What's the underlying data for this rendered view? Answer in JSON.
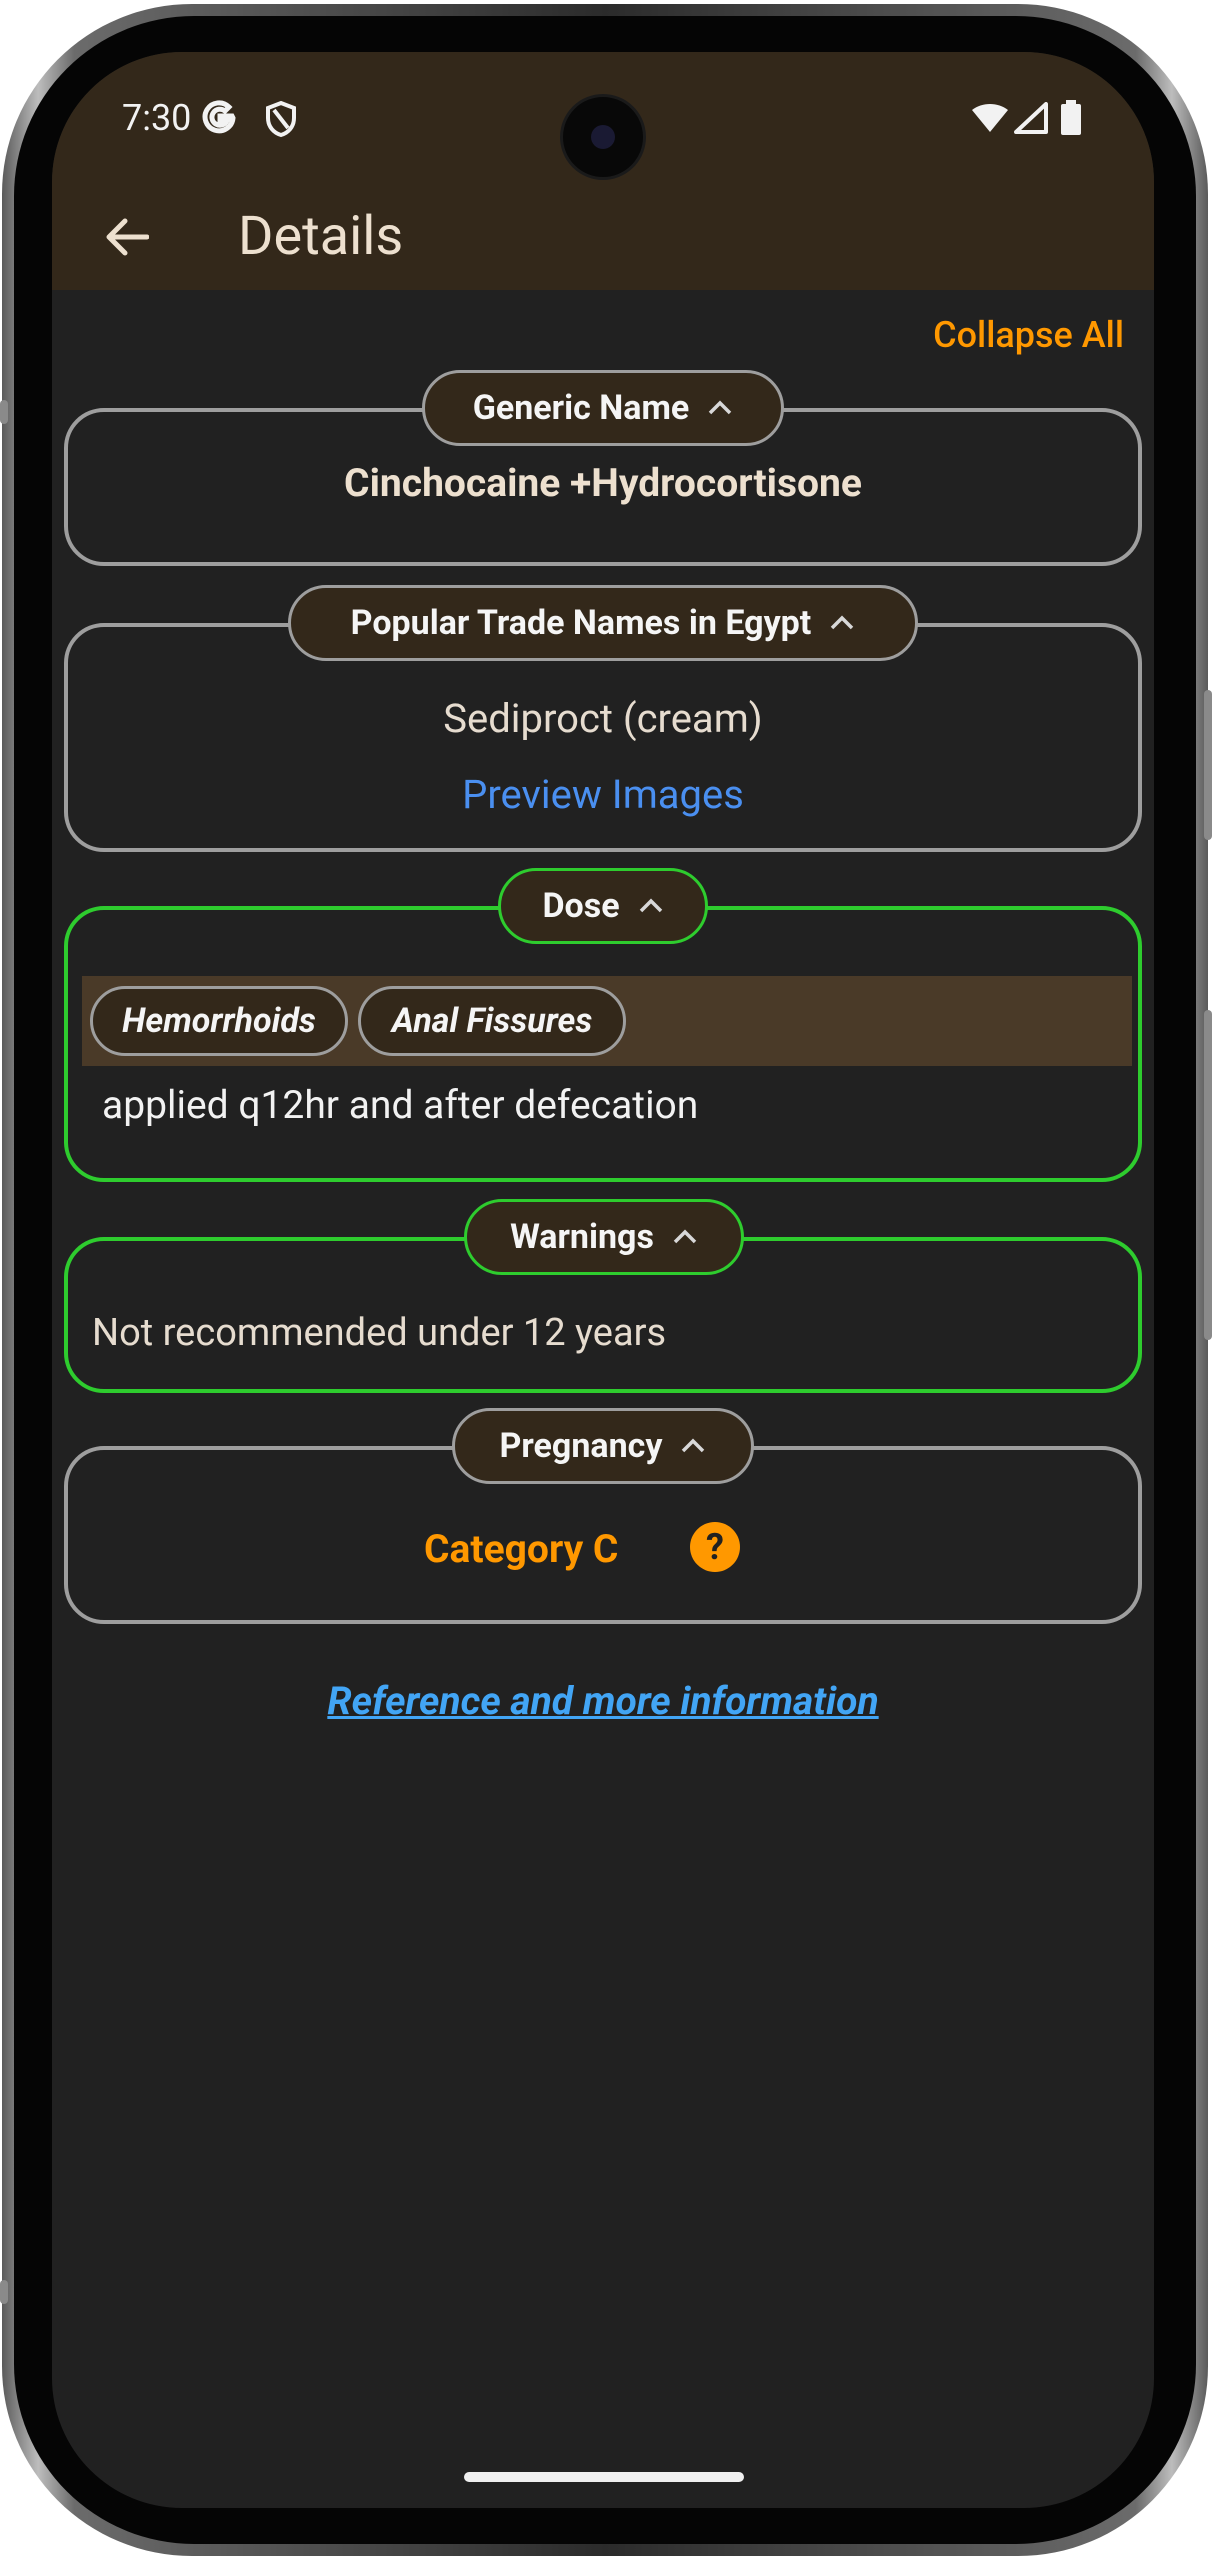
{
  "status_bar": {
    "time": "7:30"
  },
  "app_bar": {
    "title": "Details"
  },
  "toolbar": {
    "collapse_all_label": "Collapse All"
  },
  "sections": {
    "generic_name": {
      "label": "Generic Name",
      "value": "Cinchocaine +Hydrocortisone"
    },
    "trade_names": {
      "label": "Popular Trade Names in Egypt",
      "value": "Sediproct (cream)",
      "link_label": "Preview Images"
    },
    "dose": {
      "label": "Dose",
      "tags": [
        "Hemorrhoids",
        "Anal Fissures"
      ],
      "value": "applied q12hr and after defecation"
    },
    "warnings": {
      "label": "Warnings",
      "value": "Not recommended under 12 years"
    },
    "pregnancy": {
      "label": "Pregnancy",
      "value": "Category C",
      "help_icon": "?"
    }
  },
  "reference_link": "Reference and more information",
  "colors": {
    "app_bar_bg": "#33281a",
    "screen_bg": "#212121",
    "accent_orange": "#ff9800",
    "active_border": "#2ecc2e",
    "link_blue": "#42a5f5"
  }
}
